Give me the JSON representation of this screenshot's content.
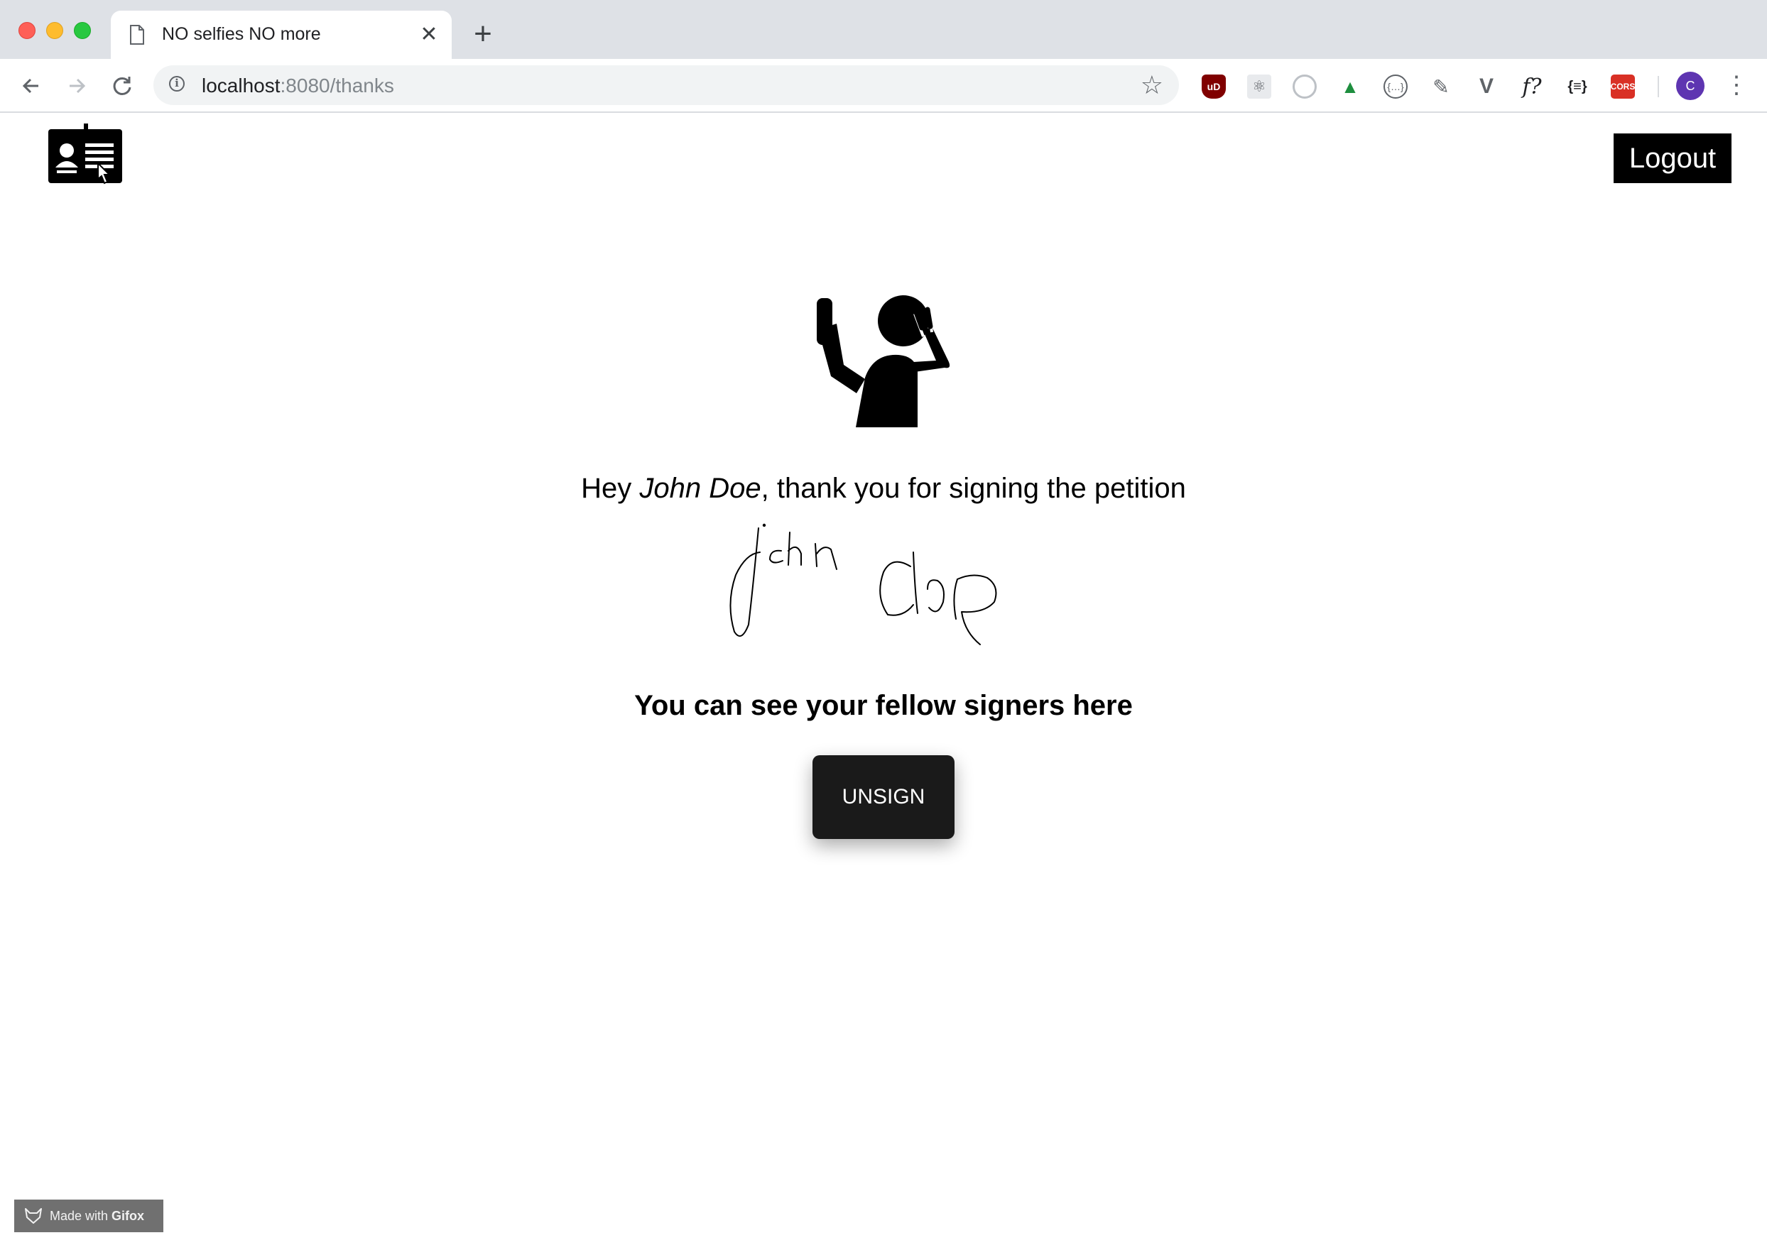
{
  "browser": {
    "tab_title": "NO selfies NO more",
    "tab_close": "✕",
    "new_tab": "+",
    "url_host": "localhost",
    "url_rest": ":8080/thanks",
    "extensions": [
      {
        "name": "ublock-origin",
        "text": "uD"
      },
      {
        "name": "react-devtools",
        "text": "⚛"
      },
      {
        "name": "extension-circle",
        "text": ""
      },
      {
        "name": "extension-green",
        "text": "▲"
      },
      {
        "name": "json-viewer",
        "text": "{…}"
      },
      {
        "name": "color-picker",
        "text": "✎"
      },
      {
        "name": "vue-devtools",
        "text": "V"
      },
      {
        "name": "font-finder",
        "text": "f?"
      },
      {
        "name": "json-formatter",
        "text": "{≡}"
      },
      {
        "name": "cors",
        "text": "CORS"
      }
    ],
    "profile_initial": "C"
  },
  "page": {
    "logout_label": "Logout",
    "greeting_prefix": "Hey ",
    "user_name": "John Doe",
    "greeting_suffix": ", thank you for signing the petition",
    "signers_link": "You can see your fellow signers here",
    "unsign_label": "UNSIGN"
  },
  "watermark": {
    "prefix": "Made with ",
    "brand": "Gifox"
  },
  "colors": {
    "chrome_bg": "#dee1e6",
    "button_bg": "#1a1a1a",
    "logout_bg": "#000000",
    "profile": "#5e35b1",
    "cors": "#d93025",
    "ublock": "#800000"
  }
}
